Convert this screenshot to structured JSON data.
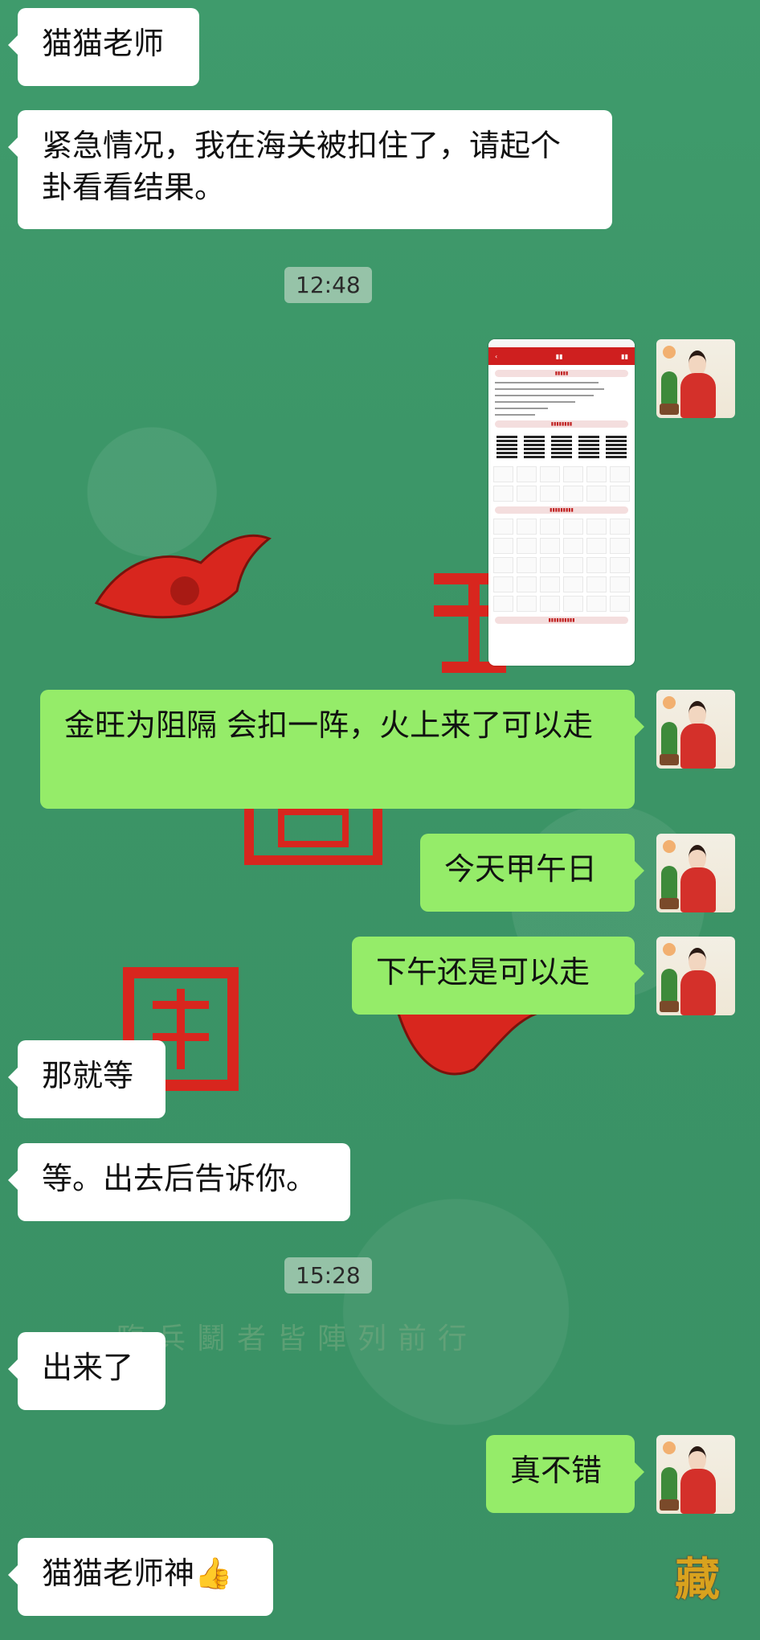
{
  "background": {
    "color": "#3e9a6c",
    "watermark_text": "臨兵鬭者皆陣列前行",
    "corner_text": "藏"
  },
  "colors": {
    "incoming_bubble": "#ffffff",
    "outgoing_bubble": "#95ec69",
    "text": "#111111"
  },
  "messages": [
    {
      "type": "in",
      "text": "猫猫老师"
    },
    {
      "type": "in",
      "text": "紧急情况，我在海关被扣住了，请起个卦看看结果。"
    },
    {
      "type": "time",
      "text": "12:48"
    },
    {
      "type": "out",
      "image": true,
      "icon": "app-screenshot-image"
    },
    {
      "type": "out",
      "text": "金旺为阻隔  会扣一阵，火上来了可以走"
    },
    {
      "type": "out",
      "text": "今天甲午日"
    },
    {
      "type": "out",
      "text": "下午还是可以走"
    },
    {
      "type": "in",
      "text": "那就等"
    },
    {
      "type": "in",
      "text": "等。出去后告诉你。"
    },
    {
      "type": "time",
      "text": "15:28"
    },
    {
      "type": "in",
      "text": "出来了"
    },
    {
      "type": "out",
      "text": "真不错"
    },
    {
      "type": "in",
      "text": "猫猫老师神👍"
    }
  ]
}
